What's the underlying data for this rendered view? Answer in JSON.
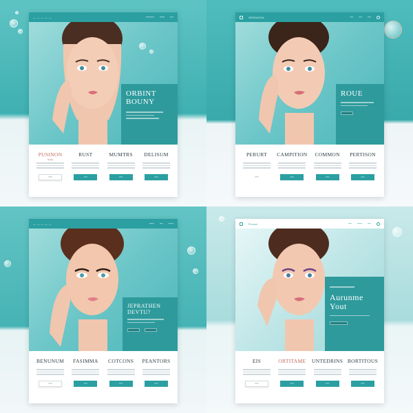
{
  "colors": {
    "teal": "#2b9fa1",
    "teal_dark": "#1f7f81",
    "text_dark": "#2c3e44",
    "accent": "#c06a5c"
  },
  "icons": [
    "search-icon",
    "menu-icon"
  ],
  "panels": [
    {
      "promo_title": "ORBINT BOUNY",
      "columns": [
        {
          "title": "PUSINON",
          "subtitle": "Retail"
        },
        {
          "title": "RUST",
          "subtitle": ""
        },
        {
          "title": "MUMTRS",
          "subtitle": ""
        },
        {
          "title": "DELISUM",
          "subtitle": ""
        }
      ]
    },
    {
      "brand": "ORENOON",
      "promo_title": "ROUE",
      "columns": [
        {
          "title": "PERURT",
          "subtitle": ""
        },
        {
          "title": "CAMPITION",
          "subtitle": ""
        },
        {
          "title": "COMMON",
          "subtitle": ""
        },
        {
          "title": "PERTISON",
          "subtitle": ""
        }
      ]
    },
    {
      "promo_title": "JEPRATHEN DEVTU?",
      "columns": [
        {
          "title": "BENUNUM",
          "subtitle": ""
        },
        {
          "title": "FASIMMA",
          "subtitle": ""
        },
        {
          "title": "COTCONS",
          "subtitle": ""
        },
        {
          "title": "PEANTORS",
          "subtitle": ""
        }
      ]
    },
    {
      "brand": "Pousa",
      "promo_title": "Aurunme Yout",
      "columns": [
        {
          "title": "EIS",
          "subtitle": ""
        },
        {
          "title": "ORTITAME",
          "subtitle": ""
        },
        {
          "title": "UNTEDRINS",
          "subtitle": ""
        },
        {
          "title": "BORTITOUS",
          "subtitle": ""
        }
      ]
    }
  ]
}
